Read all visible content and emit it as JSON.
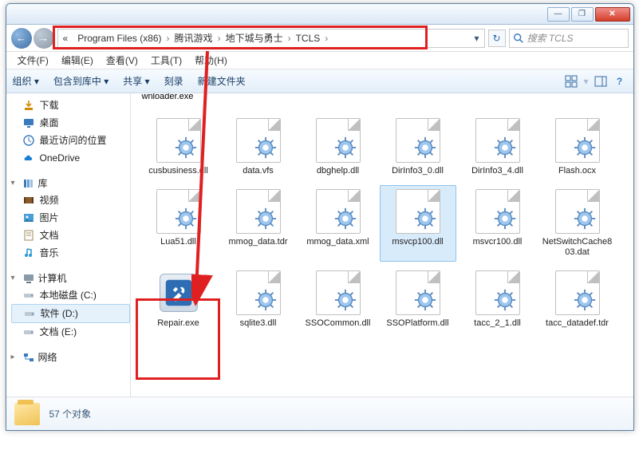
{
  "titlebar": {
    "min": "—",
    "max": "❐",
    "close": "✕"
  },
  "nav": {
    "back": "←",
    "forward": "→"
  },
  "address": {
    "prefix": "«",
    "segments": [
      "Program Files (x86)",
      "腾讯游戏",
      "地下城与勇士",
      "TCLS"
    ],
    "dropdown": "▾",
    "refresh": "↻"
  },
  "search": {
    "placeholder": "搜索 TCLS"
  },
  "menu": {
    "items": [
      "文件(F)",
      "编辑(E)",
      "查看(V)",
      "工具(T)",
      "帮助(H)"
    ]
  },
  "toolbar": {
    "items": [
      "组织 ▾",
      "包含到库中 ▾",
      "共享 ▾",
      "刻录",
      "新建文件夹"
    ]
  },
  "sidebar": {
    "groups": [
      {
        "header": "",
        "items": [
          {
            "label": "下载",
            "icon": "download"
          },
          {
            "label": "桌面",
            "icon": "desktop"
          },
          {
            "label": "最近访问的位置",
            "icon": "recent"
          },
          {
            "label": "OneDrive",
            "icon": "onedrive"
          }
        ]
      },
      {
        "header": "库",
        "items": [
          {
            "label": "视频",
            "icon": "video"
          },
          {
            "label": "图片",
            "icon": "picture"
          },
          {
            "label": "文档",
            "icon": "document"
          },
          {
            "label": "音乐",
            "icon": "music"
          }
        ]
      },
      {
        "header": "计算机",
        "items": [
          {
            "label": "本地磁盘 (C:)",
            "icon": "drive"
          },
          {
            "label": "软件 (D:)",
            "icon": "drive",
            "selected": true
          },
          {
            "label": "文档 (E:)",
            "icon": "drive"
          }
        ]
      },
      {
        "header": "网络",
        "items": []
      }
    ]
  },
  "files": [
    {
      "name": "wnloader.exe",
      "type": "gear",
      "header_only": true
    },
    {
      "name": "cusbusiness.dll",
      "type": "gear"
    },
    {
      "name": "data.vfs",
      "type": "gear"
    },
    {
      "name": "dbghelp.dll",
      "type": "gear"
    },
    {
      "name": "DirInfo3_0.dll",
      "type": "gear"
    },
    {
      "name": "DirInfo3_4.dll",
      "type": "gear"
    },
    {
      "name": "Flash.ocx",
      "type": "gear"
    },
    {
      "name": "Lua51.dll",
      "type": "gear"
    },
    {
      "name": "mmog_data.tdr",
      "type": "gear"
    },
    {
      "name": "mmog_data.xml",
      "type": "gear"
    },
    {
      "name": "msvcp100.dll",
      "type": "gear",
      "selected": true
    },
    {
      "name": "msvcr100.dll",
      "type": "gear"
    },
    {
      "name": "NetSwitchCache803.dat",
      "type": "gear"
    },
    {
      "name": "Repair.exe",
      "type": "repair",
      "highlighted": true
    },
    {
      "name": "sqlite3.dll",
      "type": "gear"
    },
    {
      "name": "SSOCommon.dll",
      "type": "gear"
    },
    {
      "name": "SSOPlatform.dll",
      "type": "gear"
    },
    {
      "name": "tacc_2_1.dll",
      "type": "gear"
    },
    {
      "name": "tacc_datadef.tdr",
      "type": "gear"
    }
  ],
  "status": {
    "count_label": "57 个对象"
  },
  "colors": {
    "highlight": "#e02020",
    "selection": "#d8ebfb"
  }
}
